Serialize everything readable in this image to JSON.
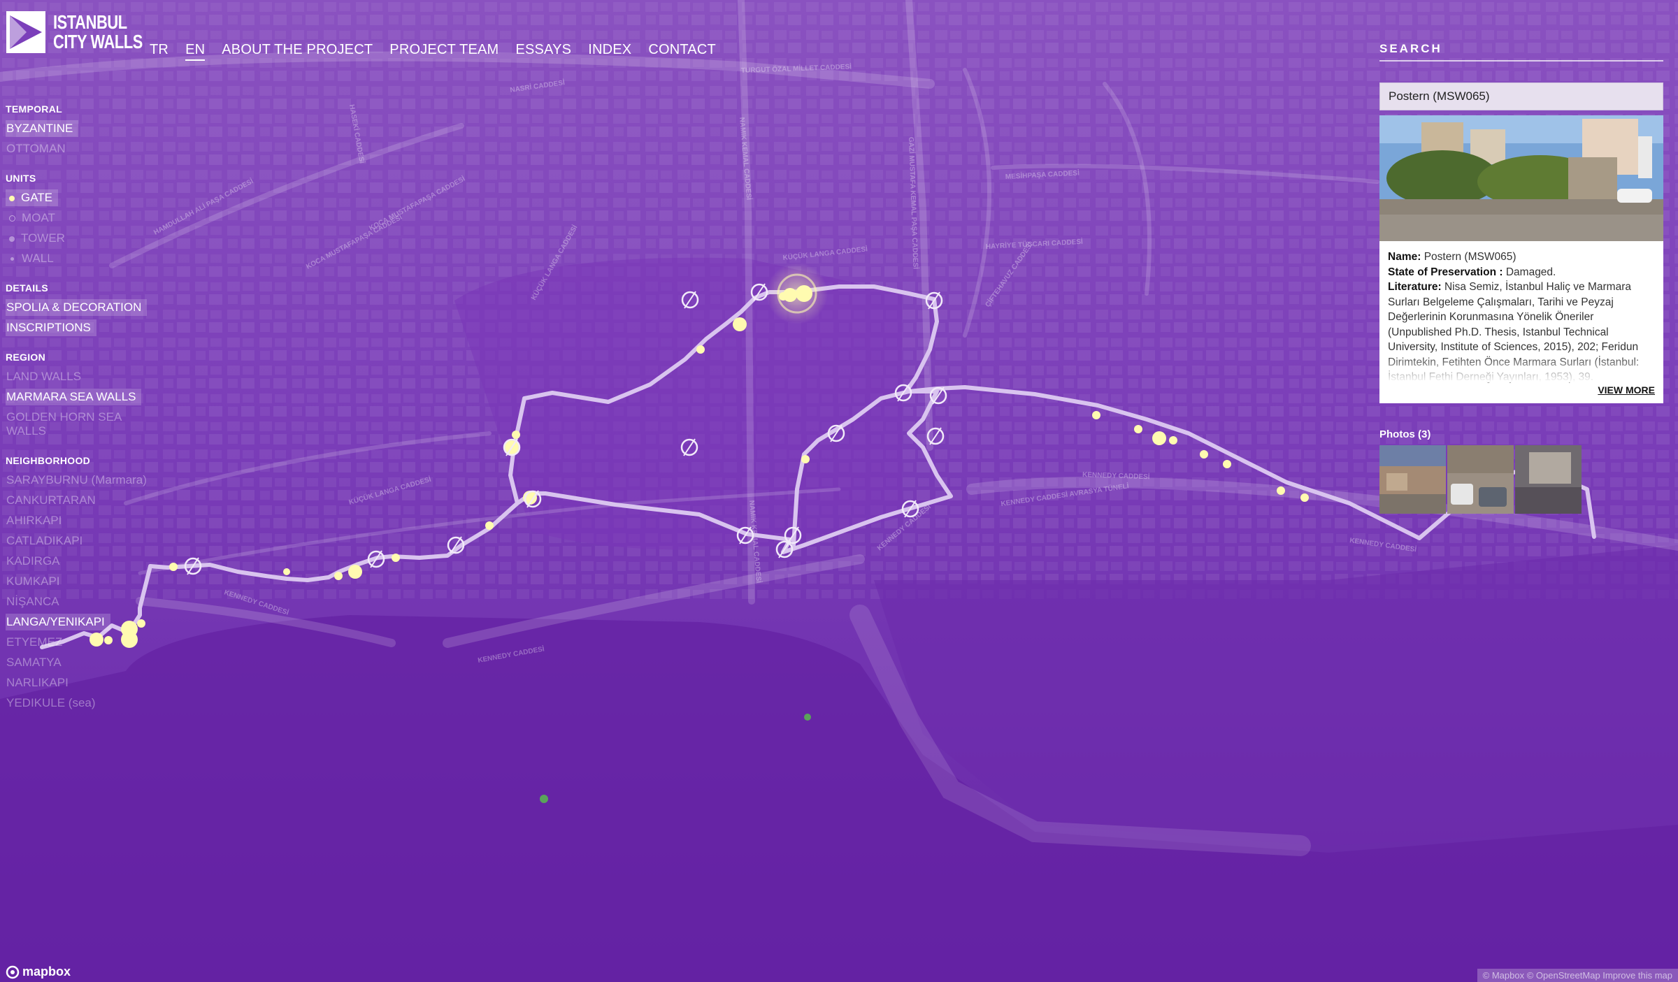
{
  "site": {
    "logo_line1": "ISTANBUL",
    "logo_line2": "CITY WALLS"
  },
  "nav": [
    {
      "label": "TR",
      "active": false
    },
    {
      "label": "EN",
      "active": true
    },
    {
      "label": "ABOUT THE PROJECT",
      "active": false
    },
    {
      "label": "PROJECT TEAM",
      "active": false
    },
    {
      "label": "ESSAYS",
      "active": false
    },
    {
      "label": "INDEX",
      "active": false
    },
    {
      "label": "CONTACT",
      "active": false
    }
  ],
  "filters": {
    "temporal": {
      "heading": "TEMPORAL",
      "items": [
        {
          "label": "BYZANTINE",
          "active": true
        },
        {
          "label": "OTTOMAN",
          "active": false
        }
      ]
    },
    "units": {
      "heading": "UNITS",
      "items": [
        {
          "label": "GATE",
          "active": true
        },
        {
          "label": "MOAT",
          "active": false
        },
        {
          "label": "TOWER",
          "active": false
        },
        {
          "label": "WALL",
          "active": false
        }
      ]
    },
    "details": {
      "heading": "DETAILS",
      "items": [
        {
          "label": "SPOLIA & DECORATION",
          "active": true
        },
        {
          "label": "INSCRIPTIONS",
          "active": true
        }
      ]
    },
    "region": {
      "heading": "REGION",
      "items": [
        {
          "label": "LAND WALLS",
          "active": false
        },
        {
          "label": "MARMARA SEA WALLS",
          "active": true
        },
        {
          "label": "GOLDEN HORN SEA WALLS",
          "active": false
        }
      ]
    },
    "neighborhood": {
      "heading": "NEIGHBORHOOD",
      "items": [
        {
          "label": "SARAYBURNU (Marmara)",
          "active": false
        },
        {
          "label": "CANKURTARAN",
          "active": false
        },
        {
          "label": "AHIRKAPI",
          "active": false
        },
        {
          "label": "CATLADIKAPI",
          "active": false
        },
        {
          "label": "KADIRGA",
          "active": false
        },
        {
          "label": "KUMKAPI",
          "active": false
        },
        {
          "label": "NİŞANCA",
          "active": false
        },
        {
          "label": "LANGA/YENIKAPI",
          "active": true
        },
        {
          "label": "ETYEMEZ",
          "active": false
        },
        {
          "label": "SAMATYA",
          "active": false
        },
        {
          "label": "NARLIKAPI",
          "active": false
        },
        {
          "label": "YEDIKULE (sea)",
          "active": false
        }
      ]
    }
  },
  "search": {
    "label": "SEARCH"
  },
  "detail": {
    "title": "Postern (MSW065)",
    "name_label": "Name:",
    "name": "Postern (MSW065)",
    "state_label": "State of Preservation :",
    "state": "Damaged.",
    "literature_label": "Literature:",
    "literature": "Nisa Semiz, İstanbul Haliç ve Marmara Surları Belgeleme Çalışmaları, Tarihi ve Peyzaj Değerlerinin Korunmasına Yönelik Öneriler (Unpublished Ph.D. Thesis, Istanbul Technical University, Institute of Sciences, 2015), 202; Feridun Dirimtekin, Fetihten Önce Marmara Surları (İstanbul: İstanbul Fethi Derneği Yayınları, 1953), 39.",
    "view_more": "VIEW MORE"
  },
  "photos": {
    "label": "Photos (3)"
  },
  "map": {
    "streets": [
      "TURGUT ÖZAL MİLLET CADDESİ",
      "NASRİ CADDESİ",
      "HASEKİ CADDESİ",
      "HAMDULLAH ALİ PAŞA CADDESİ",
      "KOCA MUSTAFAPAŞA CADDESİ",
      "KOCA MUSTAFAPAŞA CADDESİ",
      "KÜÇÜK LANGA CADDESİ",
      "KÜÇÜK LANGA CADDESİ",
      "KÜÇÜK LANGA CADDESİ",
      "NAMIK KEMAL CADDESİ",
      "GAZİ MUSTAFA KEMAL PAŞA CADDESİ",
      "MESİHPAŞA CADDESİ",
      "HAYRİYE TÜCCARI CADDESİ",
      "ÇİFTEHAVUZ CADDESİ",
      "KENNEDY CADDESİ",
      "KENNEDY CADDESİ AVRASYA TÜNELİ",
      "KENNEDY CADDESİ",
      "KENNEDY CADDESİ",
      "KENNEDY CADDESİ",
      "NAMIK KEMAL CADDESİ",
      "KENNEDY CADDESİ"
    ],
    "highlight_color": "#fffbb0",
    "route_color": "#d9c4ef"
  },
  "footer": {
    "brand": "mapbox",
    "attribution": "© Mapbox © OpenStreetMap Improve this map"
  }
}
